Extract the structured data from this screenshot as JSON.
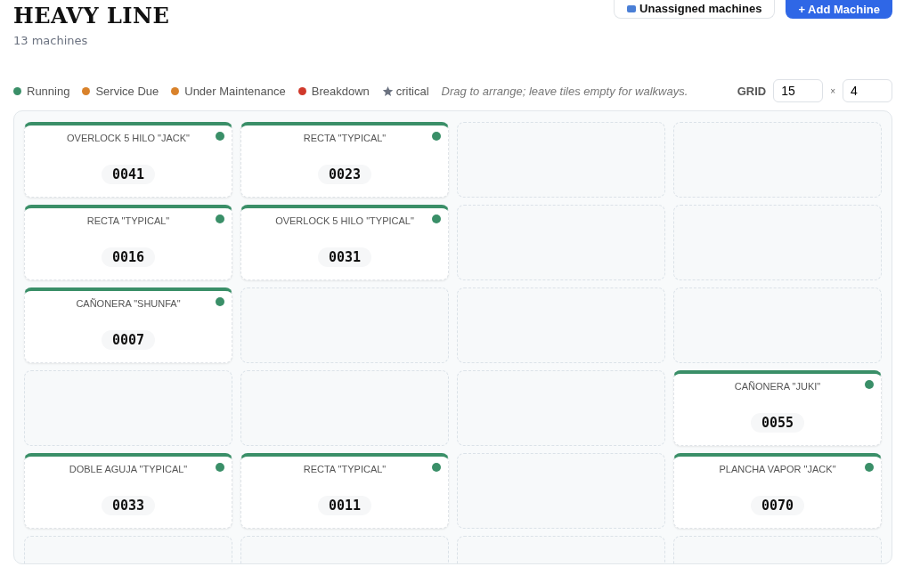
{
  "header": {
    "title": "HEAVY LINE",
    "subtitle": "13 machines",
    "buttons": [
      {
        "kind": "secondary",
        "label": "Unassigned machines"
      },
      {
        "kind": "primary",
        "label": "+ Add Machine"
      }
    ]
  },
  "legend": [
    {
      "label": "Running",
      "color": "#3a8f68"
    },
    {
      "label": "Service Due",
      "color": "#d9822b"
    },
    {
      "label": "Under Maintenance",
      "color": "#d9822b"
    },
    {
      "label": "Breakdown",
      "color": "#d0392b"
    }
  ],
  "critical_label": "critical",
  "hint": "Drag to arrange; leave tiles empty for walkways.",
  "grid_size": {
    "label": "GRID",
    "rows": "15",
    "separator": "×",
    "cols": "4"
  },
  "grid": [
    [
      {
        "kind": "machine",
        "name": "OVERLOCK 5 HILO \"JACK\"",
        "code": "0041",
        "color": "#3a8f68"
      },
      {
        "kind": "machine",
        "name": "RECTA \"TYPICAL\"",
        "code": "0023",
        "color": "#3a8f68"
      },
      {
        "kind": "empty"
      },
      {
        "kind": "empty"
      }
    ],
    [
      {
        "kind": "machine",
        "name": "RECTA \"TYPICAL\"",
        "code": "0016",
        "color": "#3a8f68"
      },
      {
        "kind": "machine",
        "name": "OVERLOCK 5 HILO \"TYPICAL\"",
        "code": "0031",
        "color": "#3a8f68"
      },
      {
        "kind": "empty"
      },
      {
        "kind": "empty"
      }
    ],
    [
      {
        "kind": "machine",
        "name": "CAÑONERA \"SHUNFA\"",
        "code": "0007",
        "color": "#3a8f68"
      },
      {
        "kind": "empty"
      },
      {
        "kind": "empty"
      },
      {
        "kind": "empty"
      }
    ],
    [
      {
        "kind": "empty"
      },
      {
        "kind": "empty"
      },
      {
        "kind": "empty"
      },
      {
        "kind": "machine",
        "name": "CAÑONERA \"JUKI\"",
        "code": "0055",
        "color": "#3a8f68"
      }
    ],
    [
      {
        "kind": "machine",
        "name": "DOBLE AGUJA \"TYPICAL\"",
        "code": "0033",
        "color": "#3a8f68"
      },
      {
        "kind": "machine",
        "name": "RECTA \"TYPICAL\"",
        "code": "0011",
        "color": "#3a8f68"
      },
      {
        "kind": "empty"
      },
      {
        "kind": "machine",
        "name": "PLANCHA VAPOR \"JACK\"",
        "code": "0070",
        "color": "#3a8f68"
      }
    ],
    [
      {
        "kind": "empty"
      },
      {
        "kind": "empty"
      },
      {
        "kind": "empty"
      },
      {
        "kind": "empty"
      }
    ]
  ]
}
